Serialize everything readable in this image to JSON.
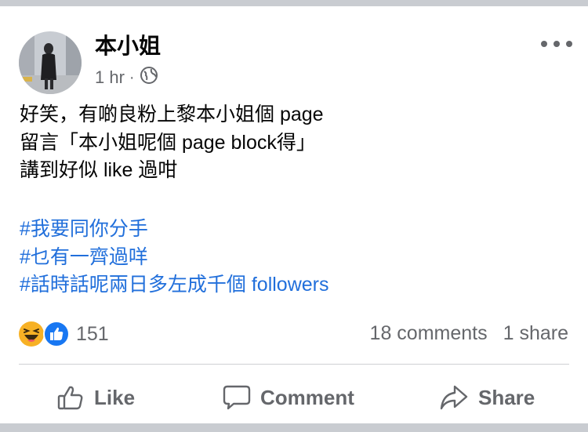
{
  "post": {
    "author": "本小姐",
    "time": "1 hr",
    "separator": "·",
    "text_lines": [
      "好笑，有啲良粉上黎本小姐個 page",
      "留言「本小姐呢個 page block得」",
      "講到好似 like 過咁"
    ],
    "hashtags": [
      "#我要同你分手",
      "#乜有一齊過咩",
      "#話時話呢兩日多左成千個 followers"
    ]
  },
  "engagement": {
    "reaction_count": "151",
    "comments": "18 comments",
    "shares": "1 share"
  },
  "actions": {
    "like": "Like",
    "comment": "Comment",
    "share": "Share"
  },
  "colors": {
    "hashtag": "#216fdb",
    "like_blue": "#1877f2",
    "haha_yellow": "#f7b125",
    "secondary_text": "#65676b"
  }
}
